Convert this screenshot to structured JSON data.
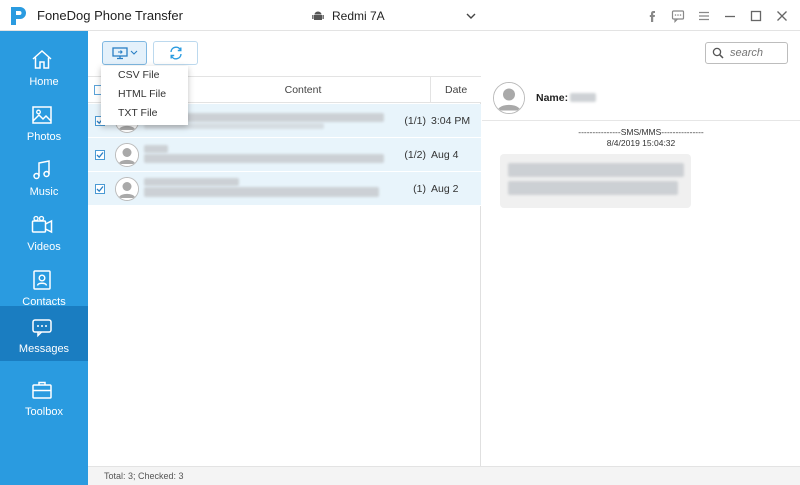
{
  "app": {
    "title": "FoneDog Phone Transfer",
    "device": "Redmi 7A",
    "accent_color": "#2a9be0",
    "active_nav_color": "#1a7dc1",
    "window_controls": [
      "facebook-icon",
      "feedback-icon",
      "menu-icon",
      "minimize-icon",
      "maximize-icon",
      "close-icon"
    ]
  },
  "sidebar": {
    "items": [
      {
        "label": "Home",
        "icon": "home-icon"
      },
      {
        "label": "Photos",
        "icon": "photo-icon"
      },
      {
        "label": "Music",
        "icon": "music-icon"
      },
      {
        "label": "Videos",
        "icon": "video-icon"
      },
      {
        "label": "Contacts",
        "icon": "contacts-icon"
      },
      {
        "label": "Messages",
        "icon": "message-icon",
        "active": true
      },
      {
        "label": "Toolbox",
        "icon": "toolbox-icon"
      }
    ]
  },
  "toolbar": {
    "export_icon": "export-to-pc-icon",
    "refresh_icon": "refresh-icon",
    "search_placeholder": "search"
  },
  "export_menu": {
    "items": [
      "CSV File",
      "HTML File",
      "TXT File"
    ]
  },
  "list": {
    "columns": {
      "content": "Content",
      "date": "Date"
    },
    "rows": [
      {
        "count": "(1/1)",
        "date": "3:04 PM",
        "checked": true
      },
      {
        "count": "(1/2)",
        "date": "Aug 4",
        "checked": true
      },
      {
        "count": "(1)",
        "date": "Aug 2",
        "checked": true
      }
    ]
  },
  "status": {
    "text": "Total: 3; Checked: 3"
  },
  "detail": {
    "name_label": "Name:",
    "sms_header": "---------------SMS/MMS---------------",
    "sms_date": "8/4/2019 15:04:32"
  }
}
